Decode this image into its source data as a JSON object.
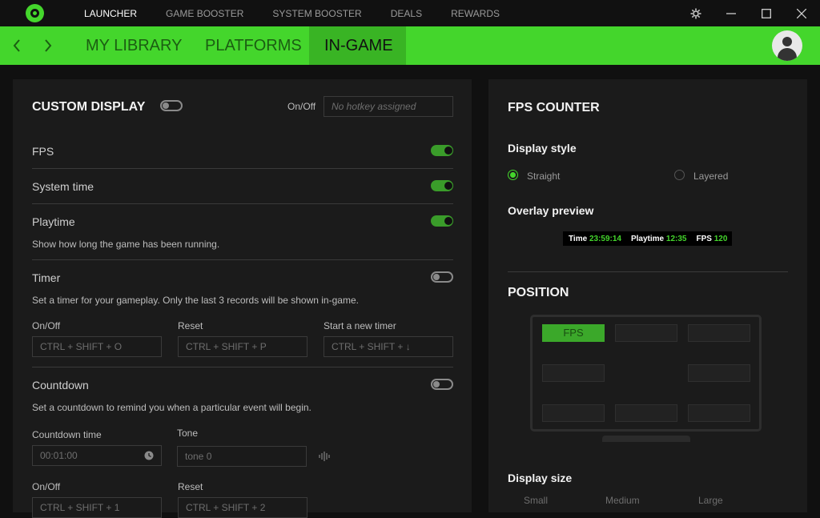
{
  "titlebar": {
    "nav": [
      "LAUNCHER",
      "GAME BOOSTER",
      "SYSTEM BOOSTER",
      "DEALS",
      "REWARDS"
    ],
    "active": "LAUNCHER"
  },
  "tabs": {
    "items": [
      "MY LIBRARY",
      "PLATFORMS",
      "IN-GAME"
    ],
    "active": "IN-GAME"
  },
  "custom_display": {
    "title": "CUSTOM DISPLAY",
    "onoff_label": "On/Off",
    "hotkey_placeholder": "No hotkey assigned",
    "enabled": false,
    "fps": {
      "label": "FPS",
      "enabled": true
    },
    "system_time": {
      "label": "System time",
      "enabled": true
    },
    "playtime": {
      "label": "Playtime",
      "desc": "Show how long the game has been running.",
      "enabled": true
    },
    "timer": {
      "label": "Timer",
      "desc": "Set a timer for your gameplay. Only the last 3 records will be shown in-game.",
      "enabled": false,
      "onoff_label": "On/Off",
      "onoff_hotkey": "CTRL + SHIFT + O",
      "reset_label": "Reset",
      "reset_hotkey": "CTRL + SHIFT + P",
      "new_label": "Start a new timer",
      "new_hotkey": "CTRL + SHIFT + ↓"
    },
    "countdown": {
      "label": "Countdown",
      "desc": "Set a countdown to remind you when a particular event will begin.",
      "enabled": false,
      "time_label": "Countdown time",
      "time_value": "00:01:00",
      "tone_label": "Tone",
      "tone_value": "tone 0",
      "onoff_label": "On/Off",
      "onoff_hotkey": "CTRL + SHIFT + 1",
      "reset_label": "Reset",
      "reset_hotkey": "CTRL + SHIFT + 2"
    }
  },
  "fps_counter": {
    "title": "FPS COUNTER",
    "display_style_label": "Display style",
    "styles": [
      "Straight",
      "Layered"
    ],
    "selected_style": "Straight",
    "overlay_label": "Overlay preview",
    "preview": {
      "time_label": "Time",
      "time_value": "23:59:14",
      "playtime_label": "Playtime",
      "playtime_value": "12:35",
      "fps_label": "FPS",
      "fps_value": "120"
    }
  },
  "position": {
    "title": "POSITION",
    "selected_label": "FPS",
    "size_label": "Display size",
    "sizes": [
      "Small",
      "Medium",
      "Large"
    ]
  },
  "colors": {
    "accent": "#44d62c",
    "background": "#101010",
    "panel": "#1b1b1b"
  }
}
